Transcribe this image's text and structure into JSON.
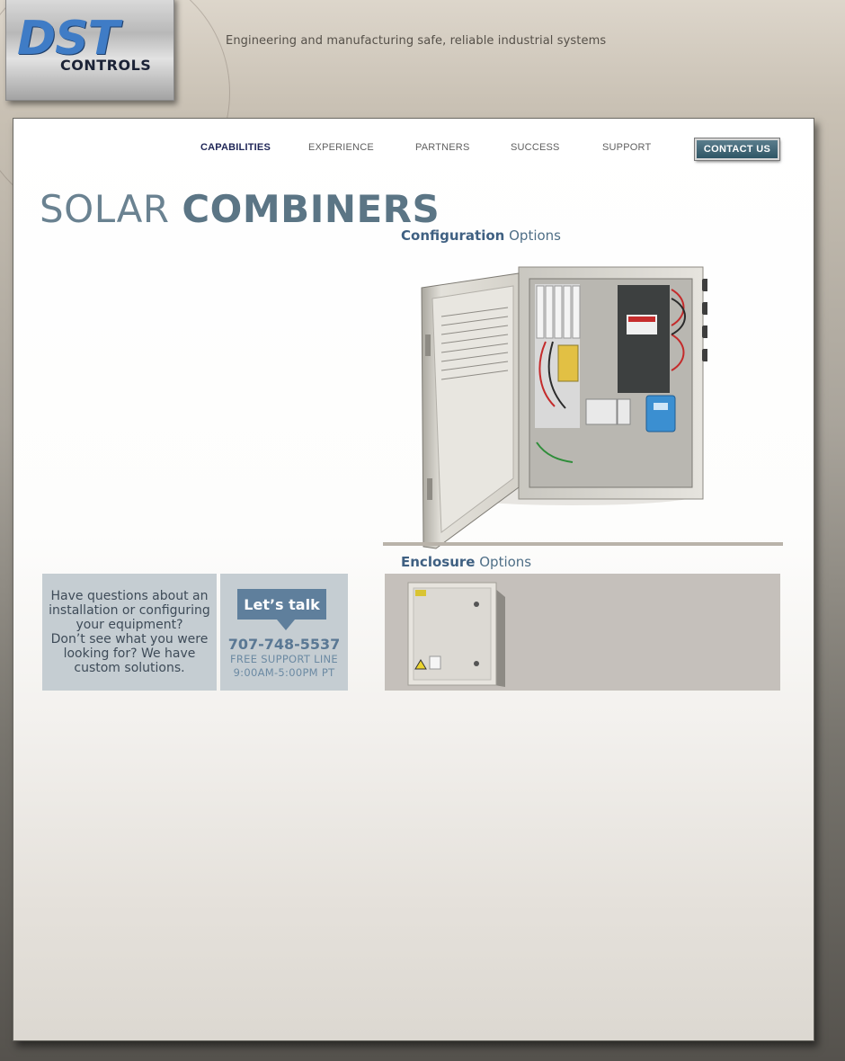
{
  "header": {
    "logo": {
      "main": "DST",
      "sub": "CONTROLS"
    },
    "tagline": "Engineering and manufacturing safe, reliable industrial systems"
  },
  "nav": {
    "items": [
      {
        "label": "CAPABILITIES",
        "active": true
      },
      {
        "label": "EXPERIENCE",
        "active": false
      },
      {
        "label": "PARTNERS",
        "active": false
      },
      {
        "label": "SUCCESS",
        "active": false
      },
      {
        "label": "SUPPORT",
        "active": false
      }
    ],
    "contact_label": "CONTACT US"
  },
  "page": {
    "title_light": "SOLAR",
    "title_bold": "COMBINERS"
  },
  "configuration": {
    "label_bold": "Configuration",
    "label_light": "Options"
  },
  "enclosure": {
    "label_bold": "Enclosure",
    "label_light": "Options"
  },
  "help": {
    "text": "Have questions about an installation or configuring your equipment?\nDon’t see what you were looking for? We have custom solutions."
  },
  "contact": {
    "talk_label": "Let’s talk",
    "phone": "707-748-5537",
    "support_line": "FREE SUPPORT LINE",
    "hours": "9:00AM-5:00PM PT"
  },
  "colors": {
    "accent_blue": "#5f7f9c",
    "nav_active": "#1f2657",
    "title": "#6a8291"
  }
}
